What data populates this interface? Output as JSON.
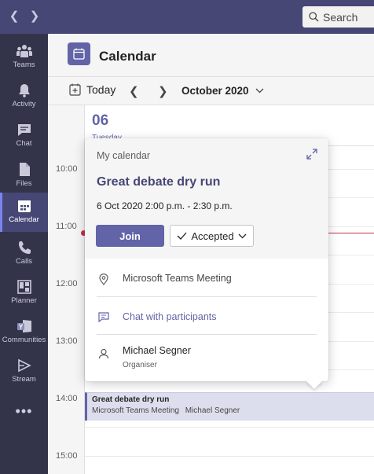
{
  "search": {
    "label": "Search"
  },
  "rail": {
    "items": [
      {
        "label": "Teams",
        "icon": "teams-icon"
      },
      {
        "label": "Activity",
        "icon": "bell-icon"
      },
      {
        "label": "Chat",
        "icon": "chat-icon"
      },
      {
        "label": "Files",
        "icon": "file-icon"
      },
      {
        "label": "Calendar",
        "icon": "calendar-icon",
        "active": true
      },
      {
        "label": "Calls",
        "icon": "phone-icon"
      },
      {
        "label": "Planner",
        "icon": "planner-icon"
      },
      {
        "label": "Communities",
        "icon": "communities-icon"
      },
      {
        "label": "Stream",
        "icon": "stream-icon"
      }
    ],
    "more": "•••"
  },
  "header": {
    "title": "Calendar"
  },
  "toolbar": {
    "today": "Today",
    "month": "October 2020"
  },
  "day": {
    "number": "06",
    "name": "Tuesday"
  },
  "times": [
    "10:00",
    "11:00",
    "12:00",
    "13:00",
    "14:00",
    "15:00"
  ],
  "event": {
    "title": "Great debate dry run",
    "location": "Microsoft Teams Meeting",
    "organizer": "Michael Segner"
  },
  "popover": {
    "calendar": "My calendar",
    "title": "Great debate dry run",
    "time": "6 Oct 2020 2:00 p.m. - 2:30 p.m.",
    "join": "Join",
    "response": "Accepted",
    "location": "Microsoft Teams Meeting",
    "chat": "Chat with participants",
    "organizer_name": "Michael Segner",
    "organizer_role": "Organiser"
  },
  "colors": {
    "brand": "#6264a7",
    "titlebar": "#464775",
    "rail": "#33344a",
    "now": "#c4314b"
  }
}
